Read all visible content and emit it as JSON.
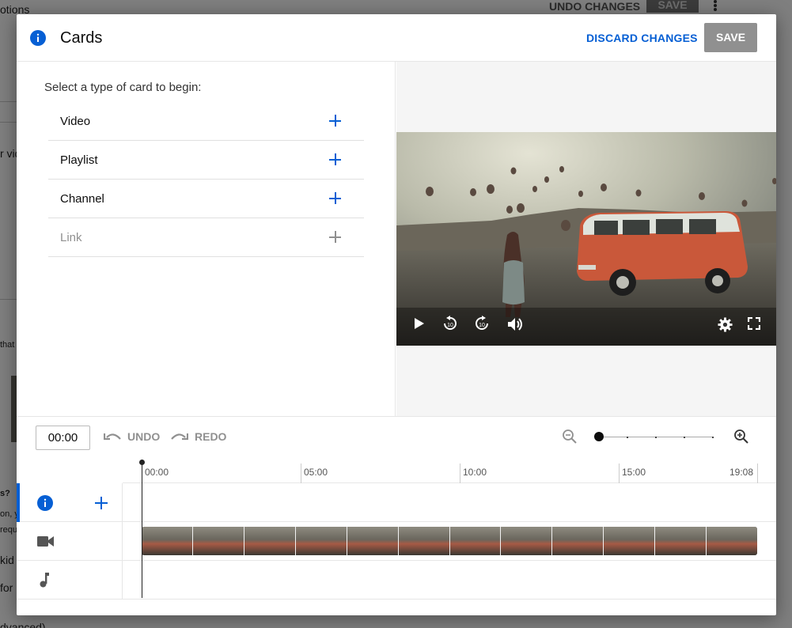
{
  "background": {
    "top_left_text": "otions",
    "undo_changes": "UNDO CHANGES",
    "save": "SAVE",
    "side_snippets": [
      "r vid",
      "that",
      "s?",
      "on, y",
      "requ",
      "kid",
      "for",
      "dvanced)"
    ]
  },
  "dialog": {
    "title": "Cards",
    "discard_label": "DISCARD CHANGES",
    "save_label": "SAVE",
    "prompt": "Select a type of card to begin:",
    "cards": [
      {
        "label": "Video",
        "enabled": true
      },
      {
        "label": "Playlist",
        "enabled": true
      },
      {
        "label": "Channel",
        "enabled": true
      },
      {
        "label": "Link",
        "enabled": false
      }
    ]
  },
  "player": {
    "controls": [
      "play-icon",
      "rewind-10-icon",
      "forward-10-icon",
      "volume-icon",
      "settings-icon",
      "fullscreen-icon"
    ]
  },
  "toolbar": {
    "time": "00:00",
    "undo_label": "UNDO",
    "redo_label": "REDO",
    "zoom_level": 0
  },
  "timeline": {
    "ticks": [
      "00:00",
      "05:00",
      "10:00",
      "15:00",
      "19:08"
    ],
    "tracks": [
      "info-icon",
      "video-camera-icon",
      "music-note-icon"
    ]
  },
  "colors": {
    "accent": "#065fd4",
    "disabled": "#909090",
    "save_bg": "#909090"
  }
}
